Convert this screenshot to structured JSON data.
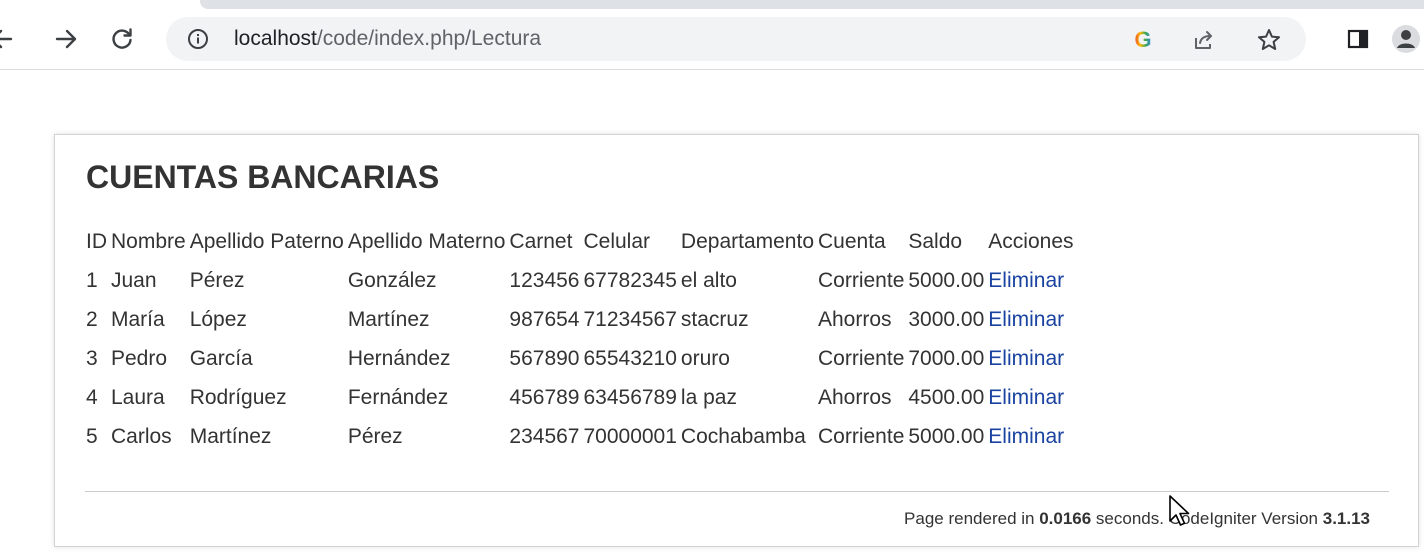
{
  "browser": {
    "url_host": "localhost",
    "url_path": "/code/index.php/Lectura",
    "icons": [
      "arrow-left-icon",
      "arrow-right-icon",
      "reload-icon",
      "info-icon",
      "google-icon",
      "share-icon",
      "star-icon",
      "side-panel-icon",
      "profile-icon"
    ],
    "google_letter": "G"
  },
  "page": {
    "title": "CUENTAS BANCARIAS",
    "columns": [
      "ID",
      "Nombre",
      "Apellido Paterno",
      "Apellido Materno",
      "Carnet",
      "Celular",
      "Departamento",
      "Cuenta",
      "Saldo",
      "Acciones"
    ],
    "rows": [
      {
        "id": "1",
        "nombre": "Juan",
        "paterno": "Pérez",
        "materno": "González",
        "carnet": "123456",
        "celular": "67782345",
        "departamento": "el alto",
        "cuenta": "Corriente",
        "saldo": "5000.00",
        "accion": "Eliminar"
      },
      {
        "id": "2",
        "nombre": "María",
        "paterno": "López",
        "materno": "Martínez",
        "carnet": "987654",
        "celular": "71234567",
        "departamento": "stacruz",
        "cuenta": "Ahorros",
        "saldo": "3000.00",
        "accion": "Eliminar"
      },
      {
        "id": "3",
        "nombre": "Pedro",
        "paterno": "García",
        "materno": "Hernández",
        "carnet": "567890",
        "celular": "65543210",
        "departamento": "oruro",
        "cuenta": "Corriente",
        "saldo": "7000.00",
        "accion": "Eliminar"
      },
      {
        "id": "4",
        "nombre": "Laura",
        "paterno": "Rodríguez",
        "materno": "Fernández",
        "carnet": "456789",
        "celular": "63456789",
        "departamento": "la paz",
        "cuenta": "Ahorros",
        "saldo": "4500.00",
        "accion": "Eliminar"
      },
      {
        "id": "5",
        "nombre": "Carlos",
        "paterno": "Martínez",
        "materno": "Pérez",
        "carnet": "234567",
        "celular": "70000001",
        "departamento": "Cochabamba",
        "cuenta": "Corriente",
        "saldo": "5000.00",
        "accion": "Eliminar"
      }
    ],
    "footer": {
      "prefix": "Page rendered in ",
      "time": "0.0166",
      "middle": " seconds. CodeIgniter Version ",
      "version": "3.1.13"
    }
  },
  "colors": {
    "link": "#1a43a1",
    "title": "#333333",
    "omnibox": "#f1f3f4"
  }
}
